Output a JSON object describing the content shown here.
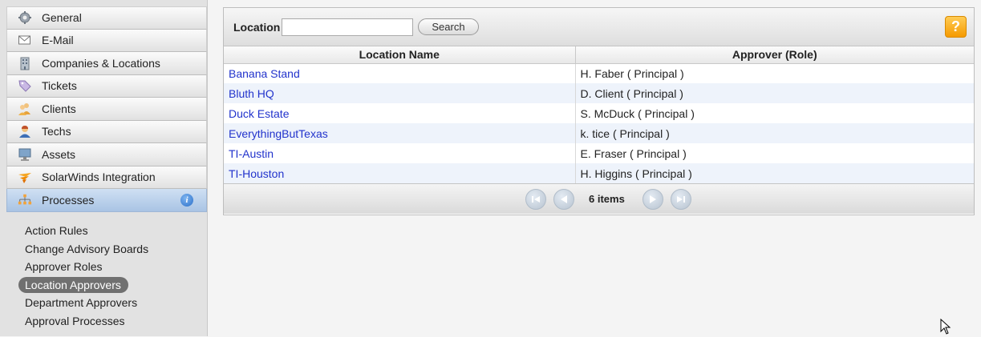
{
  "sidebar": {
    "items": [
      {
        "label": "General",
        "icon": "gear-icon"
      },
      {
        "label": "E-Mail",
        "icon": "envelope-icon"
      },
      {
        "label": "Companies & Locations",
        "icon": "building-icon"
      },
      {
        "label": "Tickets",
        "icon": "tag-icon"
      },
      {
        "label": "Clients",
        "icon": "users-icon"
      },
      {
        "label": "Techs",
        "icon": "tech-user-icon"
      },
      {
        "label": "Assets",
        "icon": "monitor-icon"
      },
      {
        "label": "SolarWinds Integration",
        "icon": "solarwinds-icon"
      },
      {
        "label": "Processes",
        "icon": "processes-icon",
        "active": true
      }
    ],
    "info_glyph": "i",
    "subitems": [
      {
        "label": "Action Rules"
      },
      {
        "label": "Change Advisory Boards"
      },
      {
        "label": "Approver Roles"
      },
      {
        "label": "Location Approvers",
        "selected": true
      },
      {
        "label": "Department Approvers"
      },
      {
        "label": "Approval Processes"
      }
    ]
  },
  "toolbar": {
    "location_label": "Location",
    "location_value": "",
    "search_label": "Search",
    "help_glyph": "?"
  },
  "table": {
    "headers": [
      "Location Name",
      "Approver (Role)"
    ],
    "rows": [
      {
        "location": "Banana Stand",
        "approver": "H. Faber ( Principal )"
      },
      {
        "location": "Bluth HQ",
        "approver": "D. Client ( Principal )"
      },
      {
        "location": "Duck Estate",
        "approver": "S. McDuck ( Principal )"
      },
      {
        "location": "EverythingButTexas",
        "approver": "k. tice ( Principal )"
      },
      {
        "location": "TI-Austin",
        "approver": "E. Fraser ( Principal )"
      },
      {
        "location": "TI-Houston",
        "approver": "H. Higgins ( Principal )"
      }
    ]
  },
  "pager": {
    "count_text": "6 items"
  },
  "colors": {
    "link": "#2233cc",
    "alt_row": "#eef3fb",
    "active_nav": "#a9c4e4",
    "selected_subnav": "#707070",
    "help_orange": "#f59a00"
  }
}
